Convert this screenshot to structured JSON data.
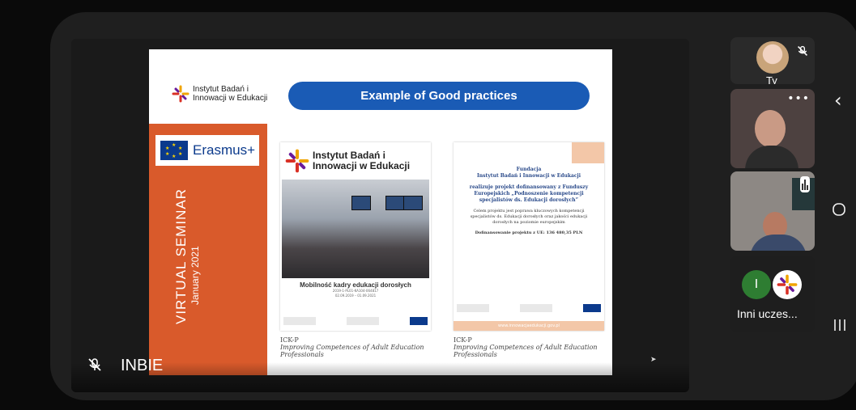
{
  "presenter": {
    "name": "INBIE"
  },
  "slide": {
    "banner_title": "Example of Good practices",
    "institute_name_line1": "Instytut Badań i",
    "institute_name_line2": "Innowacji w Edukacji",
    "erasmus_label": "Erasmus+",
    "vertical_title": "VIRTUAL SEMINAR",
    "vertical_date": "January 2021",
    "card1": {
      "brand_line1": "Instytut Badań i",
      "brand_line2": "Innowacji w Edukacji",
      "caption": "Mobilność kadry edukacji dorosłych",
      "small1": "2019-1-PL01-KA104-064817",
      "small2": "02.09.2019 – 01.09.2021"
    },
    "card2": {
      "title1": "Fundacja",
      "title2": "Instytut Badań i Innowacji w Edukacji",
      "line1": "realizuje projekt dofinansowany z Funduszy",
      "line2": "Europejskich „Podnoszenie kompetencji",
      "line3": "specjalistów ds. Edukacji dorosłych”",
      "small": "Celem projektu jest poprawa kluczowych kompetencji specjalistów ds. Edukacji dorosłych oraz jakości edukacji dorosłych na poziomie europejskim",
      "amount": "Dofinansowanie projektu z UE: 136 480,35 PLN",
      "footer": "www.innowacjaedukacji.gov.pl"
    },
    "notes": {
      "col1_code": "ICK-P",
      "col1_text1": "Improving Competences of Adult Education",
      "col1_text2": "Professionals",
      "col2_code": "ICK-P",
      "col2_text1": "Improving Competences of Adult Education",
      "col2_text2": "Professionals"
    }
  },
  "participants": {
    "self_label": "Ty",
    "others_label": "Inni uczes...",
    "others_initial": "I"
  },
  "colors": {
    "accent_orange": "#d95a2b",
    "banner_blue": "#1a5bb5",
    "erasmus_blue": "#0b3a8c"
  }
}
